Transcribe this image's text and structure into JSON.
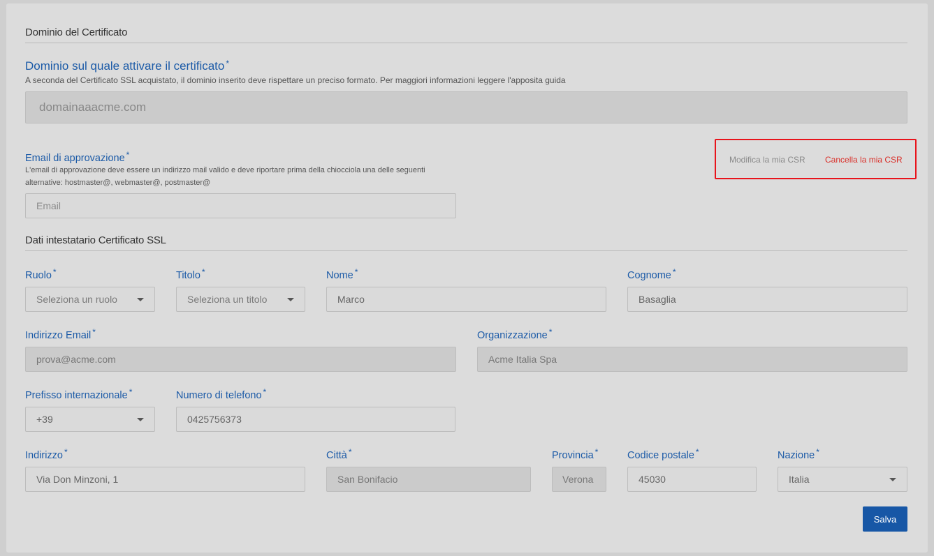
{
  "certificate_domain": {
    "section_title": "Dominio del Certificato",
    "label": "Dominio sul quale attivare il certificato",
    "required": "*",
    "help": "A seconda del Certificato SSL acquistato, il dominio inserito deve rispettare un preciso formato. Per maggiori informazioni leggere l'apposita guida",
    "value": "domainaaacme.com"
  },
  "approval_email": {
    "label": "Email di approvazione",
    "required": "*",
    "help_line1": "L'email di approvazione deve essere un indirizzo mail valido e deve riportare prima della chiocciola una delle seguenti",
    "help_line2": "alternative: hostmaster@, webmaster@, postmaster@",
    "placeholder": "Email"
  },
  "csr": {
    "edit_label": "Modifica la mia CSR",
    "delete_label": "Cancella la mia CSR",
    "edit_color": "#8a8a8a",
    "delete_color": "#d9302a"
  },
  "holder": {
    "section_title": "Dati intestatario Certificato SSL",
    "required": "*",
    "fields": {
      "ruolo": {
        "label": "Ruolo",
        "value": "Seleziona un ruolo"
      },
      "titolo": {
        "label": "Titolo",
        "value": "Seleziona un titolo"
      },
      "nome": {
        "label": "Nome",
        "value": "Marco"
      },
      "cognome": {
        "label": "Cognome",
        "value": "Basaglia"
      },
      "email": {
        "label": "Indirizzo Email",
        "value": "prova@acme.com"
      },
      "organizzazione": {
        "label": "Organizzazione",
        "value": "Acme Italia Spa"
      },
      "prefisso": {
        "label": "Prefisso internazionale",
        "value": "+39"
      },
      "telefono": {
        "label": "Numero di telefono",
        "value": "0425756373"
      },
      "indirizzo": {
        "label": "Indirizzo",
        "value": "Via Don Minzoni, 1"
      },
      "citta": {
        "label": "Città",
        "value": "San Bonifacio"
      },
      "provincia": {
        "label": "Provincia",
        "value": "Verona"
      },
      "cap": {
        "label": "Codice postale",
        "value": "45030"
      },
      "nazione": {
        "label": "Nazione",
        "value": "Italia"
      }
    }
  },
  "actions": {
    "save_label": "Salva"
  },
  "colors": {
    "label_blue": "#1b5aa7",
    "button_blue": "#1757a6",
    "highlight_red": "#e8141c"
  }
}
